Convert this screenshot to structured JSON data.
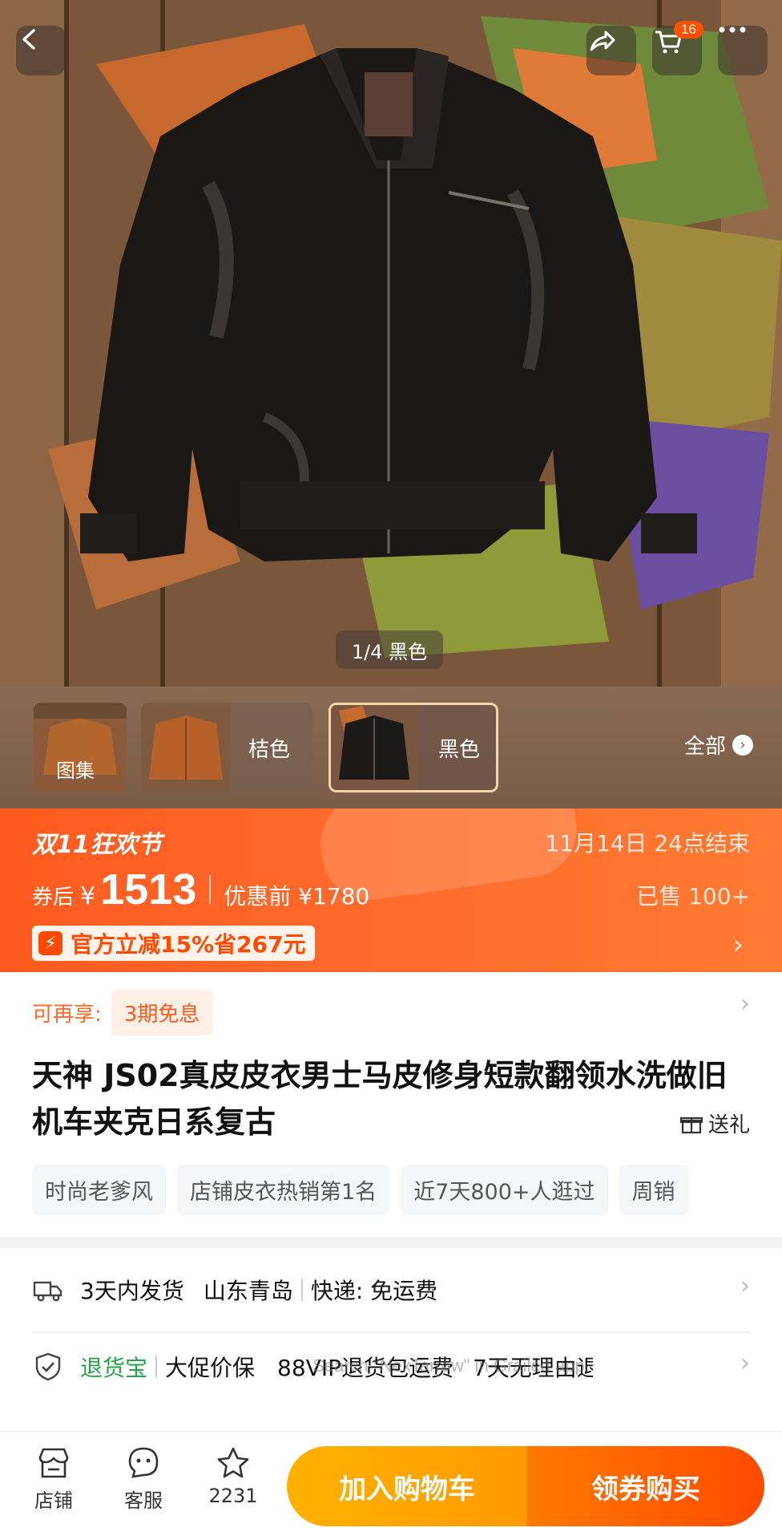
{
  "header": {
    "cart_count": "16",
    "image_indicator": "1/4 黑色"
  },
  "variants": {
    "gallery_label": "图集",
    "items": [
      {
        "label": "桔色"
      },
      {
        "label": "黑色"
      }
    ],
    "all_label": "全部"
  },
  "promo": {
    "festival": "双11狂欢节",
    "ends": "11月14日 24点结束",
    "price_prefix": "券后",
    "currency": "¥",
    "price": "1513",
    "original_price": "优惠前 ¥1780",
    "sold": "已售 100+",
    "offer": "官方立减15%省267元"
  },
  "info": {
    "installment_label": "可再享:",
    "installment_value": "3期免息",
    "title": "天神 JS02真皮皮衣男士马皮修身短款翻领水洗做旧机车夹克日系复古",
    "gift": "送礼",
    "tags": [
      "时尚老爹风",
      "店铺皮衣热销第1名",
      "近7天800+人逛过",
      "周销"
    ]
  },
  "service": {
    "shipping": [
      "3天内发货",
      "山东青岛",
      "快递: 免运费"
    ],
    "guarantee_brand": "退货宝",
    "guarantee": [
      "大促价保",
      "88VIP退货包运费",
      "7天无理由退"
    ],
    "watermark_line1": "Search \"NexTarrow\" in Grailed app."
  },
  "bottom_bar": {
    "store": "店铺",
    "service": "客服",
    "favorites": "2231",
    "add_to_cart": "加入购物车",
    "buy": "领券购买"
  }
}
